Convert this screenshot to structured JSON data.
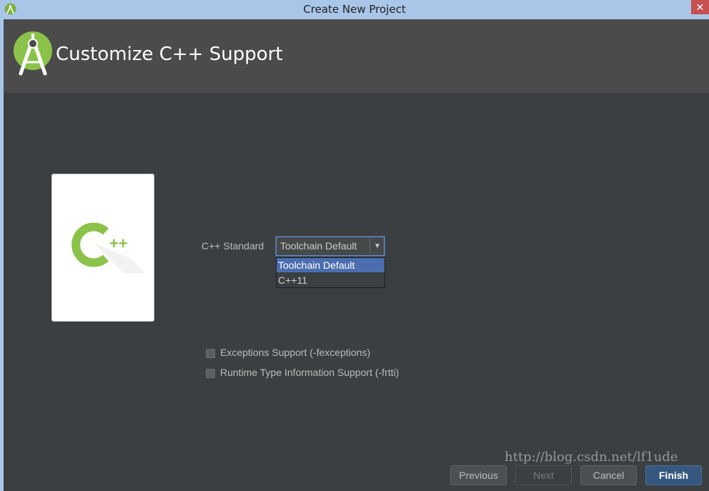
{
  "window": {
    "title": "Create New Project",
    "close_glyph": "✕"
  },
  "header": {
    "title": "Customize C++ Support",
    "logo_icon": "android-studio-icon"
  },
  "card": {
    "icon": "cpp-icon",
    "glyph_plus": "++"
  },
  "cpp_standard": {
    "label": "C++ Standard",
    "selected": "Toolchain Default",
    "arrow": "▼",
    "options": [
      "Toolchain Default",
      "C++11"
    ]
  },
  "options": {
    "exceptions": {
      "label": "Exceptions Support (-fexceptions)",
      "checked": false
    },
    "rtti": {
      "label": "Runtime Type Information Support (-frtti)",
      "checked": false
    }
  },
  "buttons": {
    "previous": "Previous",
    "next": "Next",
    "cancel": "Cancel",
    "finish": "Finish"
  },
  "watermark": "http://blog.csdn.net/lf1ude",
  "colors": {
    "accent": "#4b6eaf",
    "android_green": "#8bc34a",
    "background": "#3c3f41"
  }
}
